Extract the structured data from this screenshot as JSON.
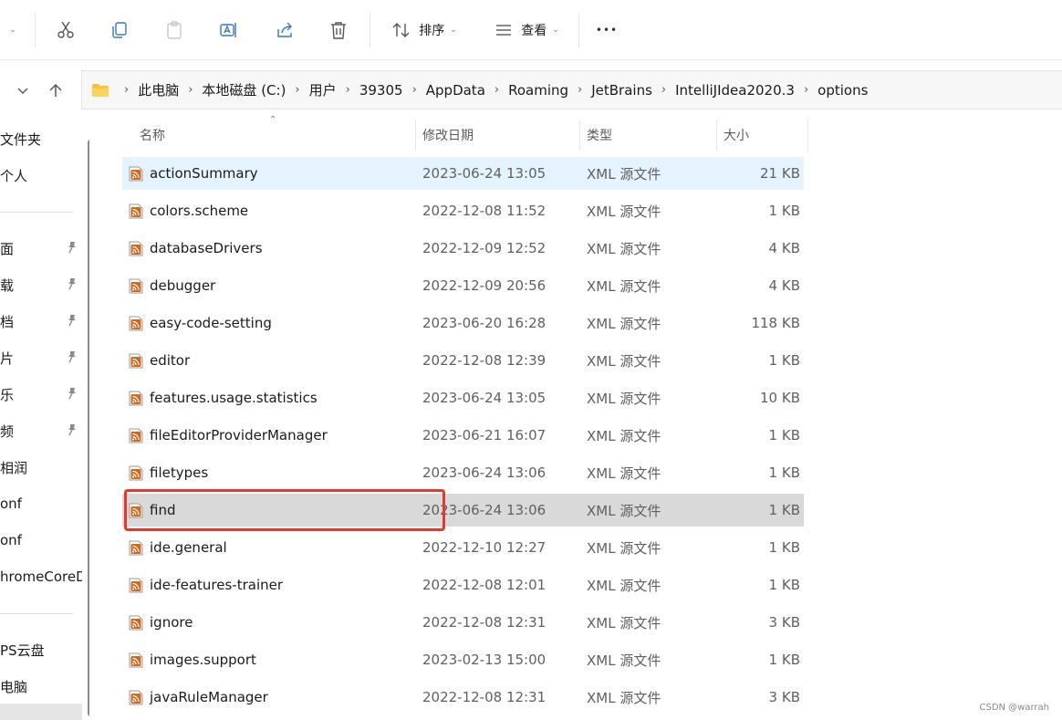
{
  "toolbar": {
    "sort_label": "排序",
    "view_label": "查看",
    "more_label": "•••"
  },
  "breadcrumb": {
    "items": [
      "此电脑",
      "本地磁盘 (C:)",
      "用户",
      "39305",
      "AppData",
      "Roaming",
      "JetBrains",
      "IntelliJIdea2020.3",
      "options"
    ]
  },
  "sidebar": {
    "items": [
      {
        "label": "文件夹",
        "pinned": false
      },
      {
        "label": "个人",
        "pinned": false
      },
      {
        "label": "面",
        "pinned": true
      },
      {
        "label": "载",
        "pinned": true
      },
      {
        "label": "档",
        "pinned": true
      },
      {
        "label": "片",
        "pinned": true
      },
      {
        "label": "乐",
        "pinned": true
      },
      {
        "label": "频",
        "pinned": true
      },
      {
        "label": "相润",
        "pinned": false
      },
      {
        "label": "onf",
        "pinned": false
      },
      {
        "label": "onf",
        "pinned": false
      },
      {
        "label": "hromeCoreDo",
        "pinned": false
      },
      {
        "label": "PS云盘",
        "pinned": false
      },
      {
        "label": "电脑",
        "pinned": false
      }
    ]
  },
  "columns": {
    "name": "名称",
    "date": "修改日期",
    "type": "类型",
    "size": "大小"
  },
  "files": [
    {
      "name": "actionSummary",
      "date": "2023-06-24 13:05",
      "type": "XML 源文件",
      "size": "21 KB"
    },
    {
      "name": "colors.scheme",
      "date": "2022-12-08 11:52",
      "type": "XML 源文件",
      "size": "1 KB"
    },
    {
      "name": "databaseDrivers",
      "date": "2022-12-09 12:52",
      "type": "XML 源文件",
      "size": "4 KB"
    },
    {
      "name": "debugger",
      "date": "2022-12-09 20:56",
      "type": "XML 源文件",
      "size": "4 KB"
    },
    {
      "name": "easy-code-setting",
      "date": "2023-06-20 16:28",
      "type": "XML 源文件",
      "size": "118 KB"
    },
    {
      "name": "editor",
      "date": "2022-12-08 12:39",
      "type": "XML 源文件",
      "size": "1 KB"
    },
    {
      "name": "features.usage.statistics",
      "date": "2023-06-24 13:05",
      "type": "XML 源文件",
      "size": "10 KB"
    },
    {
      "name": "fileEditorProviderManager",
      "date": "2023-06-21 16:07",
      "type": "XML 源文件",
      "size": "1 KB"
    },
    {
      "name": "filetypes",
      "date": "2023-06-24 13:06",
      "type": "XML 源文件",
      "size": "1 KB"
    },
    {
      "name": "find",
      "date": "2023-06-24 13:06",
      "type": "XML 源文件",
      "size": "1 KB"
    },
    {
      "name": "ide.general",
      "date": "2022-12-10 12:27",
      "type": "XML 源文件",
      "size": "1 KB"
    },
    {
      "name": "ide-features-trainer",
      "date": "2022-12-08 12:01",
      "type": "XML 源文件",
      "size": "1 KB"
    },
    {
      "name": "ignore",
      "date": "2022-12-08 12:31",
      "type": "XML 源文件",
      "size": "3 KB"
    },
    {
      "name": "images.support",
      "date": "2023-02-13 15:00",
      "type": "XML 源文件",
      "size": "1 KB"
    },
    {
      "name": "javaRuleManager",
      "date": "2022-12-08 12:31",
      "type": "XML 源文件",
      "size": "3 KB"
    }
  ],
  "hovered_file": "actionSummary",
  "selected_file": "find",
  "watermark": "CSDN @warrah",
  "colors": {
    "hover": "#e5f3ff",
    "selected": "#d9d9d9",
    "highlight_box": "#e23a2e",
    "xml_icon": "#d2691e"
  }
}
